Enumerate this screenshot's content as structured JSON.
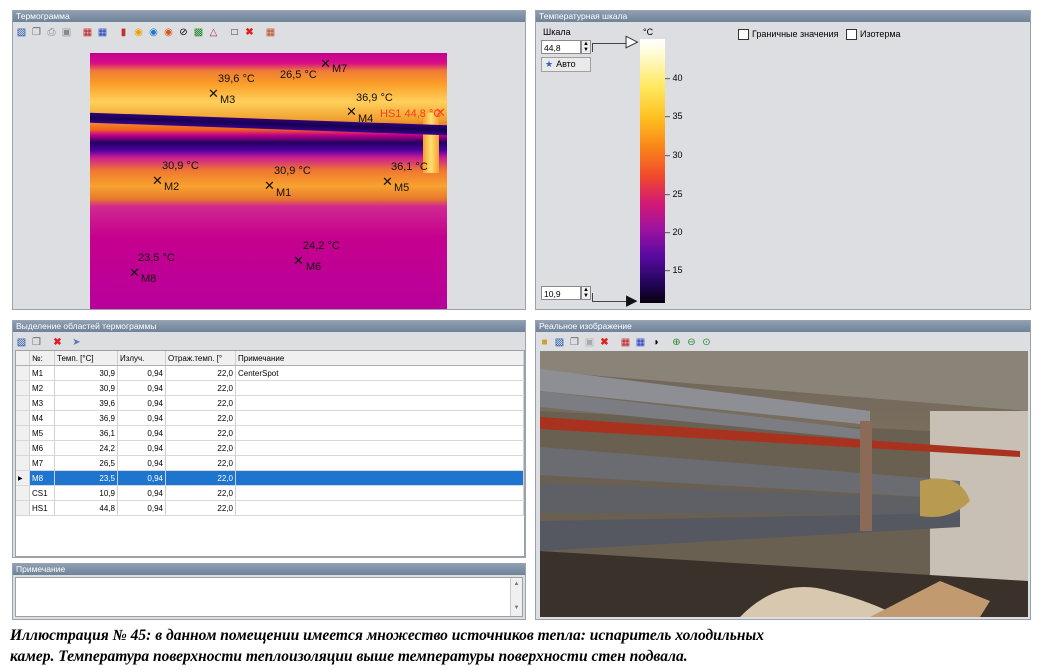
{
  "panels": {
    "thermogram": "Термограмма",
    "temp_scale": "Температурная шкала",
    "regions": "Выделение областей термограммы",
    "note": "Примечание",
    "real_image": "Реальное изображение"
  },
  "markers": [
    {
      "name": "M1",
      "temp": "30,9 °C"
    },
    {
      "name": "M2",
      "temp": "30,9 °C"
    },
    {
      "name": "M3",
      "temp": "39,6 °C"
    },
    {
      "name": "M4",
      "temp": "36,9 °C"
    },
    {
      "name": "M5",
      "temp": "36,1 °C"
    },
    {
      "name": "M6",
      "temp": "24,2 °C"
    },
    {
      "name": "M7",
      "temp": "26,5 °C"
    },
    {
      "name": "M8",
      "temp": "23,5 °C"
    }
  ],
  "hotspot": {
    "label": "HS1 44,8 °C"
  },
  "scale": {
    "label": "Шкала",
    "max_value": "44,8",
    "min_value": "10,9",
    "auto_label": "Авто",
    "unit": "°C",
    "ticks": [
      "40",
      "35",
      "30",
      "25",
      "20",
      "15"
    ],
    "limits_label": "Граничные значения",
    "isotherm_label": "Изотерма"
  },
  "table": {
    "headers": [
      "№:",
      "Темп. [°C]",
      "Излуч.",
      "Отраж.темп. [°",
      "Примечание"
    ],
    "rows": [
      [
        "M1",
        "30,9",
        "0,94",
        "22,0",
        "CenterSpot"
      ],
      [
        "M2",
        "30,9",
        "0,94",
        "22,0",
        ""
      ],
      [
        "M3",
        "39,6",
        "0,94",
        "22,0",
        ""
      ],
      [
        "M4",
        "36,9",
        "0,94",
        "22,0",
        ""
      ],
      [
        "M5",
        "36,1",
        "0,94",
        "22,0",
        ""
      ],
      [
        "M6",
        "24,2",
        "0,94",
        "22,0",
        ""
      ],
      [
        "M7",
        "26,5",
        "0,94",
        "22,0",
        ""
      ],
      [
        "M8",
        "23,5",
        "0,94",
        "22,0",
        ""
      ],
      [
        "CS1",
        "10,9",
        "0,94",
        "22,0",
        ""
      ],
      [
        "HS1",
        "44,8",
        "0,94",
        "22,0",
        ""
      ]
    ],
    "selected_index": 7
  },
  "colors": {
    "selection": "#1e75d0",
    "hotspot": "#ff3b1e",
    "delete": "#e02020"
  },
  "caption": {
    "line1": "Иллюстрация № 45: в данном помещении имеется множество источников тепла: испаритель холодильных",
    "line2": "камер. Температура поверхности теплоизоляции выше температуры поверхности стен подвала."
  }
}
